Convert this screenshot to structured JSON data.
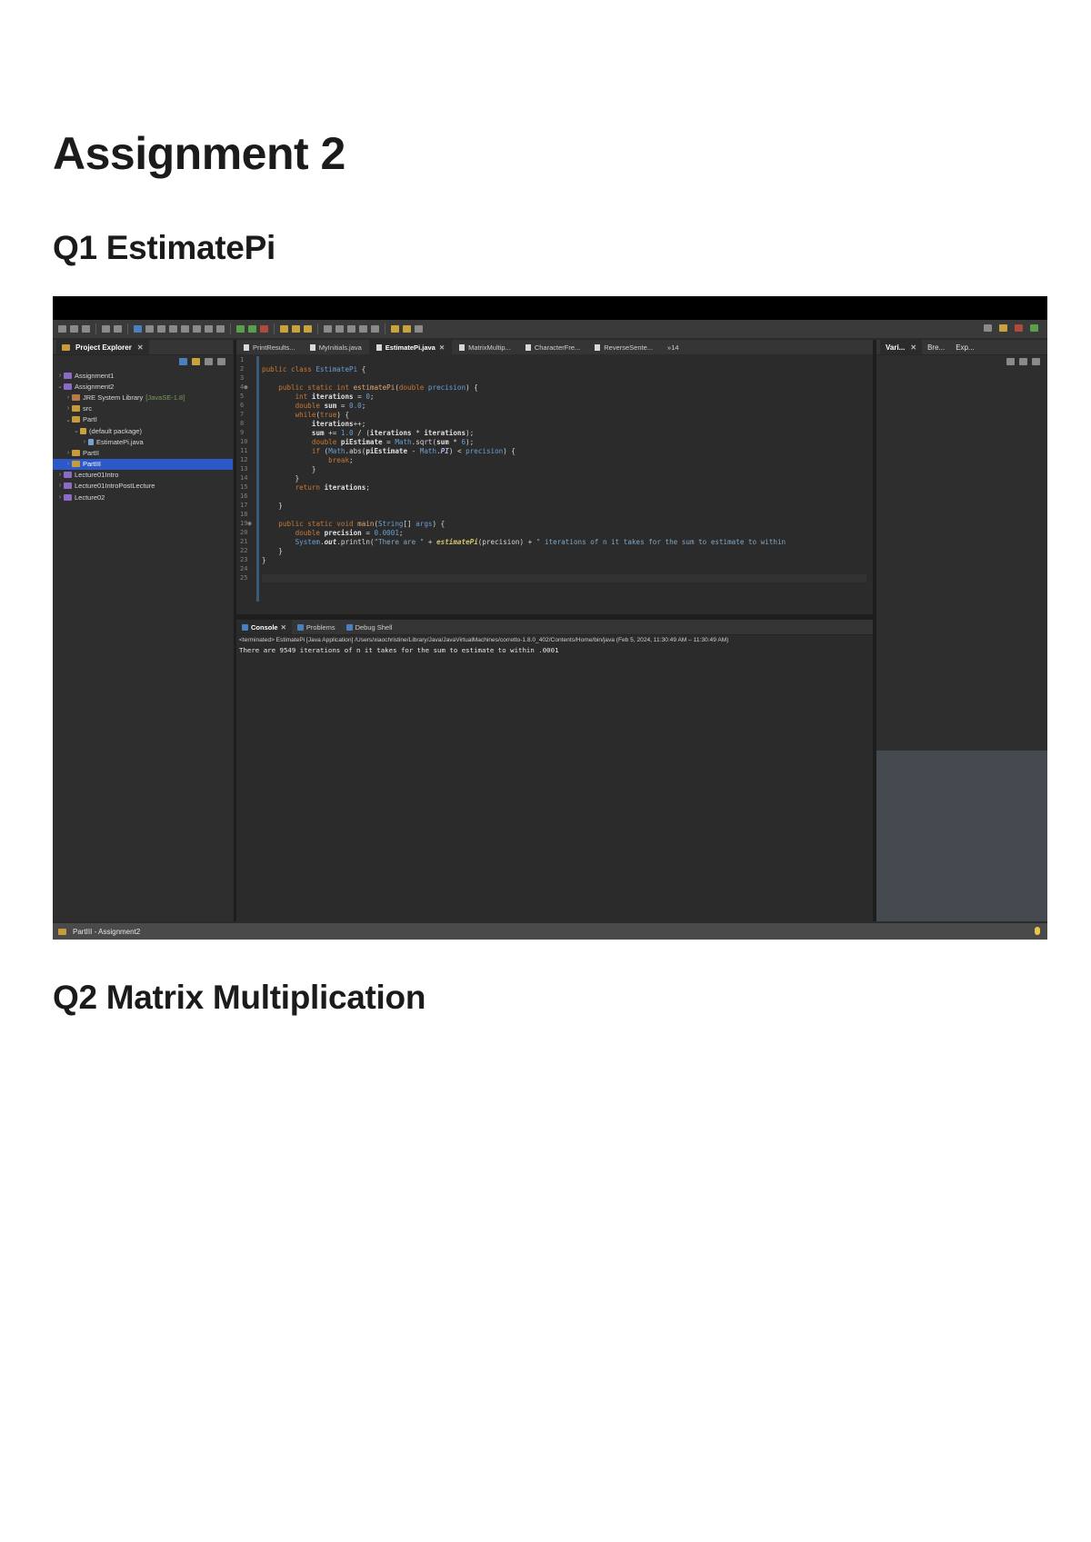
{
  "document": {
    "title": "Assignment 2",
    "sections": [
      {
        "heading": "Q1 EstimatePi"
      },
      {
        "heading": "Q2 Matrix Multiplication"
      }
    ]
  },
  "ide": {
    "explorer": {
      "tab_label": "Project Explorer",
      "tree": [
        {
          "label": "Assignment1",
          "depth": 0,
          "type": "proj",
          "chev": ">"
        },
        {
          "label": "Assignment2",
          "depth": 0,
          "type": "proj",
          "chev": "v"
        },
        {
          "label": "JRE System Library",
          "suffix": "[JavaSE-1.8]",
          "depth": 1,
          "type": "lib",
          "chev": ">"
        },
        {
          "label": "src",
          "depth": 1,
          "type": "folder",
          "chev": ">"
        },
        {
          "label": "PartI",
          "depth": 1,
          "type": "folder",
          "chev": "v"
        },
        {
          "label": "(default package)",
          "depth": 2,
          "type": "pkg",
          "chev": "v"
        },
        {
          "label": "EstimatePi.java",
          "depth": 3,
          "type": "file",
          "chev": ">"
        },
        {
          "label": "PartII",
          "depth": 1,
          "type": "folder",
          "chev": ">"
        },
        {
          "label": "PartIII",
          "depth": 1,
          "type": "folder",
          "chev": ">",
          "selected": true
        },
        {
          "label": "Lecture01Intro",
          "depth": 0,
          "type": "proj",
          "chev": ">"
        },
        {
          "label": "Lecture01IntroPostLecture",
          "depth": 0,
          "type": "proj",
          "chev": ">"
        },
        {
          "label": "Lecture02",
          "depth": 0,
          "type": "proj",
          "chev": ">"
        }
      ]
    },
    "editor_tabs": [
      {
        "label": "PrintResults..."
      },
      {
        "label": "MyInitials.java"
      },
      {
        "label": "EstimatePi.java",
        "active": true
      },
      {
        "label": "MatrixMultip..."
      },
      {
        "label": "CharacterFre..."
      },
      {
        "label": "ReverseSente..."
      },
      {
        "label": "»14"
      }
    ],
    "code_lines": [
      {
        "n": "1",
        "html": ""
      },
      {
        "n": "2",
        "html": "<span class='kw'>public class</span> <span class='cls'>EstimatePi</span> {"
      },
      {
        "n": "3",
        "html": ""
      },
      {
        "n": "4●",
        "html": "    <span class='kw'>public static int</span> <span class='ital' style='color:#e6a86a;font-style:normal;font-weight:400'>estimatePi</span>(<span class='kw'>double</span> <span class='cls'>precision</span>) {"
      },
      {
        "n": "5",
        "html": "        <span class='kw'>int</span> <span class='var'>iterations</span> = <span class='num'>0</span>;"
      },
      {
        "n": "6",
        "html": "        <span class='kw'>double</span> <span class='var'>sum</span> = <span class='num'>0.0</span>;"
      },
      {
        "n": "7",
        "html": "        <span class='kw'>while</span>(<span class='kw'>true</span>) {"
      },
      {
        "n": "8",
        "html": "            <span class='var'>iterations</span>++;"
      },
      {
        "n": "9",
        "html": "            <span class='var'>sum</span> += <span class='num'>1.0</span> / (<span class='var'>iterations</span> * <span class='var'>iterations</span>);"
      },
      {
        "n": "10",
        "html": "            <span class='kw'>double</span> <span class='var'>piEstimate</span> = <span class='cls'>Math</span>.sqrt(<span class='var'>sum</span> * <span class='num'>6</span>);"
      },
      {
        "n": "11",
        "html": "            <span class='kw'>if</span> (<span class='cls'>Math</span>.abs(<span class='var'>piEstimate</span> - <span class='cls'>Math</span>.<span class='ital' style='color:#a9b7e6'>PI</span>) &lt; <span class='cls'>precision</span>) {"
      },
      {
        "n": "12",
        "html": "                <span class='kw'>break</span>;"
      },
      {
        "n": "13",
        "html": "            }"
      },
      {
        "n": "14",
        "html": "        }"
      },
      {
        "n": "15",
        "html": "        <span class='kw'>return</span> <span class='var'>iterations</span>;"
      },
      {
        "n": "16",
        "html": ""
      },
      {
        "n": "17",
        "html": "    }"
      },
      {
        "n": "18",
        "html": ""
      },
      {
        "n": "19●",
        "html": "    <span class='kw'>public static void</span> <span style='color:#e6a86a'>main</span>(<span class='cls'>String</span>[] <span class='cls'>args</span>) {"
      },
      {
        "n": "20",
        "html": "        <span class='kw'>double</span> <span class='var'>precision</span> = <span class='num'>0.0001</span>;"
      },
      {
        "n": "21",
        "html": "        <span class='cls'>System</span>.<span class='var' style='font-style:italic'>out</span>.println(<span class='str'>\"There are \"</span> + <span class='ital'>estimatePi</span>(precision) + <span class='str'>\" iterations of n it takes for the sum to estimate to within</span>"
      },
      {
        "n": "22",
        "html": "    }"
      },
      {
        "n": "23",
        "html": "}"
      },
      {
        "n": "24",
        "html": ""
      },
      {
        "n": "25",
        "html": ""
      }
    ],
    "console": {
      "tabs": [
        {
          "label": "Console",
          "active": true
        },
        {
          "label": "Problems"
        },
        {
          "label": "Debug Shell"
        }
      ],
      "meta": "<terminated> EstimatePi [Java Application] /Users/xiaochristine/Library/Java/JavaVirtualMachines/corretto-1.8.0_402/Contents/Home/bin/java (Feb 5, 2024, 11:30:49 AM – 11:30:49 AM)",
      "output": "There are 9549 iterations of n it takes for the sum to estimate to within .0001"
    },
    "right_tabs": [
      {
        "label": "Vari..."
      },
      {
        "label": "Bre..."
      },
      {
        "label": "Exp..."
      }
    ],
    "status": "PartIII - Assignment2"
  }
}
